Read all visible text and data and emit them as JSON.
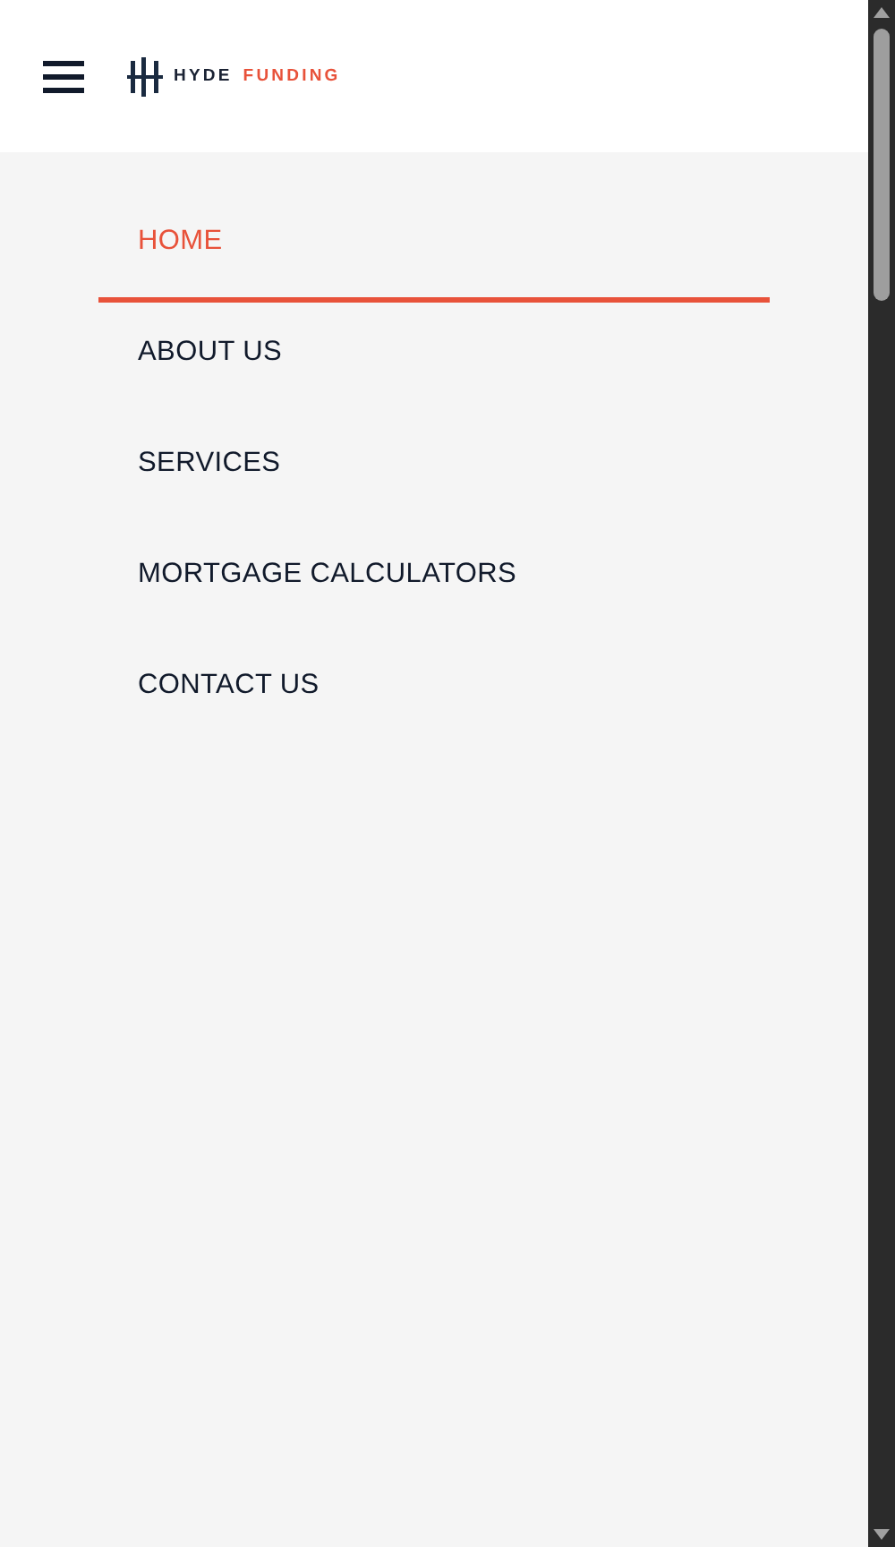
{
  "header": {
    "brand": {
      "first_word": "HYDE",
      "second_word": "FUNDING"
    }
  },
  "menu": {
    "items": [
      {
        "label": "HOME",
        "selected": true
      },
      {
        "label": "ABOUT US",
        "selected": false
      },
      {
        "label": "SERVICES",
        "selected": false
      },
      {
        "label": "MORTGAGE CALCULATORS",
        "selected": false
      },
      {
        "label": "CONTACT US",
        "selected": false
      }
    ]
  }
}
